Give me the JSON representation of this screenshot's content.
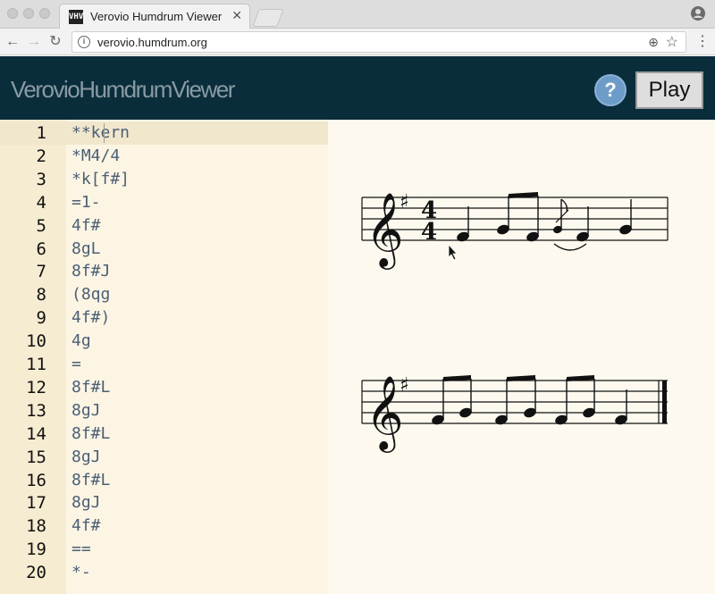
{
  "browser": {
    "tab_title": "Verovio Humdrum Viewer",
    "favicon_text": "VHV",
    "url": "verovio.humdrum.org",
    "icons": [
      "back-icon",
      "forward-icon",
      "reload-icon",
      "info-icon",
      "zoom-icon",
      "star-icon",
      "menu-icon",
      "profile-icon",
      "close-icon"
    ]
  },
  "header": {
    "title": "VerovioHumdrumViewer",
    "help_label": "?",
    "play_label": "Play"
  },
  "editor": {
    "lines": [
      {
        "n": "1",
        "code": "**kern"
      },
      {
        "n": "2",
        "code": "*M4/4"
      },
      {
        "n": "3",
        "code": "*k[f#]"
      },
      {
        "n": "4",
        "code": "=1-"
      },
      {
        "n": "5",
        "code": "4f#"
      },
      {
        "n": "6",
        "code": "8gL"
      },
      {
        "n": "7",
        "code": "8f#J"
      },
      {
        "n": "8",
        "code": "(8qg"
      },
      {
        "n": "9",
        "code": "4f#)"
      },
      {
        "n": "10",
        "code": "4g"
      },
      {
        "n": "11",
        "code": "="
      },
      {
        "n": "12",
        "code": "8f#L"
      },
      {
        "n": "13",
        "code": "8gJ"
      },
      {
        "n": "14",
        "code": "8f#L"
      },
      {
        "n": "15",
        "code": "8gJ"
      },
      {
        "n": "16",
        "code": "8f#L"
      },
      {
        "n": "17",
        "code": "8gJ"
      },
      {
        "n": "18",
        "code": "4f#"
      },
      {
        "n": "19",
        "code": "=="
      },
      {
        "n": "20",
        "code": "*-"
      }
    ]
  },
  "score": {
    "systems": [
      {
        "clef": "treble",
        "key_signature": "F#",
        "time_signature": "4/4",
        "notes": [
          {
            "pitch": "f#",
            "duration": "quarter"
          },
          {
            "pitch": "g",
            "duration": "eighth",
            "beam": "start"
          },
          {
            "pitch": "f#",
            "duration": "eighth",
            "beam": "end"
          },
          {
            "pitch": "g",
            "duration": "grace"
          },
          {
            "pitch": "f#",
            "duration": "quarter",
            "slur_end": true
          },
          {
            "pitch": "g",
            "duration": "quarter"
          }
        ]
      },
      {
        "clef": "treble",
        "key_signature": "F#",
        "notes": [
          {
            "pitch": "f#",
            "duration": "eighth",
            "beam": "start"
          },
          {
            "pitch": "g",
            "duration": "eighth",
            "beam": "end"
          },
          {
            "pitch": "f#",
            "duration": "eighth",
            "beam": "start"
          },
          {
            "pitch": "g",
            "duration": "eighth",
            "beam": "end"
          },
          {
            "pitch": "f#",
            "duration": "eighth",
            "beam": "start"
          },
          {
            "pitch": "g",
            "duration": "eighth",
            "beam": "end"
          },
          {
            "pitch": "f#",
            "duration": "quarter"
          }
        ],
        "final_barline": true
      }
    ]
  }
}
